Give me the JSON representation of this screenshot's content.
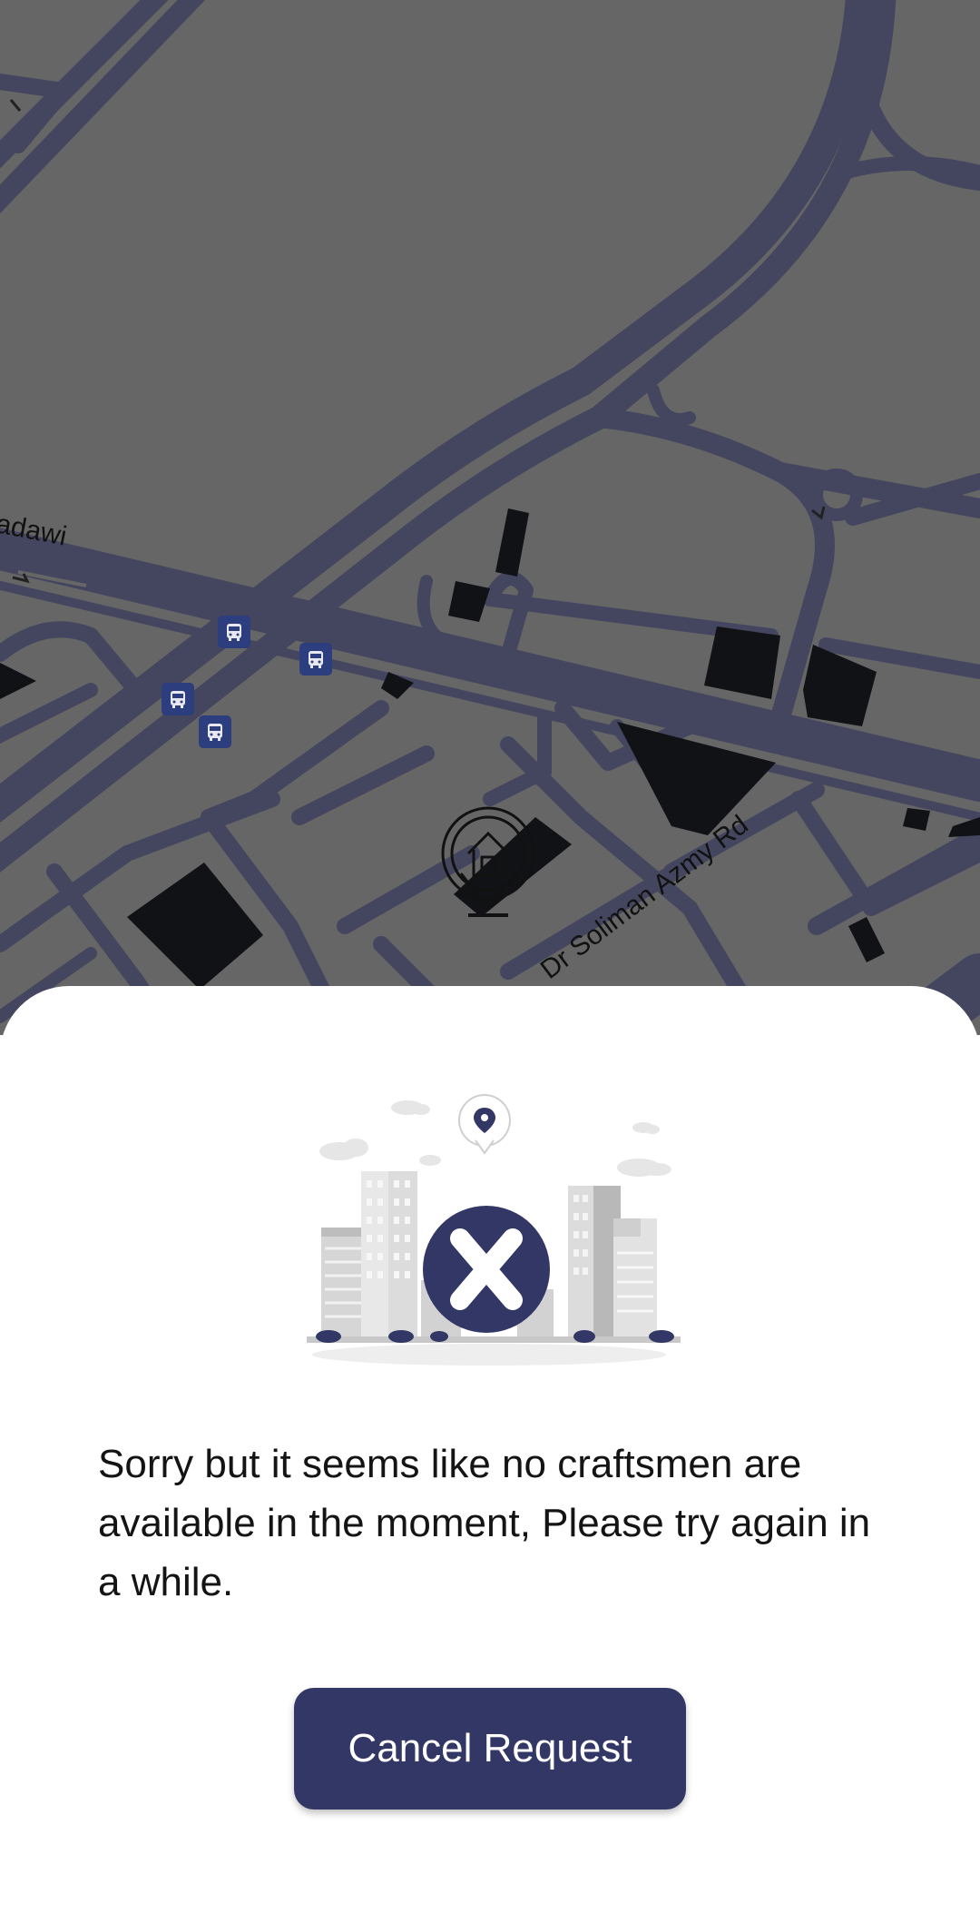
{
  "map": {
    "street_labels": [
      "adawi",
      "Dr Soliman Azmy Rd"
    ],
    "bus_stop_icon": "bus-icon",
    "home_marker_icon": "home-pin-icon",
    "colors": {
      "land": "#666666",
      "roads": "#44465f",
      "buildings": "#111216",
      "bus_stop": "#2d3e7e"
    }
  },
  "sheet": {
    "illustration_icon": "no-craftsmen-city-icon",
    "message": "Sorry but it seems like no craftsmen are available in the moment, Please try again in a while.",
    "cancel_label": "Cancel Request",
    "colors": {
      "accent": "#323766",
      "text": "#141414"
    }
  }
}
